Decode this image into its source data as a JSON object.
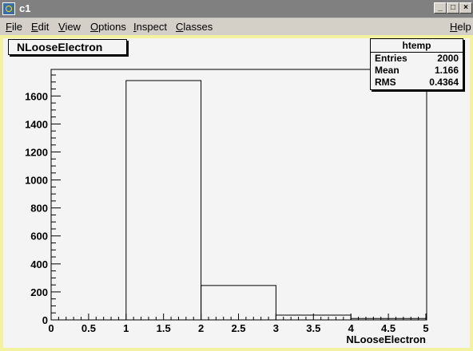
{
  "window": {
    "title": "c1",
    "minimize": "_",
    "maximize": "□",
    "close": "×"
  },
  "menu": {
    "file": {
      "accel": "F",
      "rest": "ile"
    },
    "edit": {
      "accel": "E",
      "rest": "dit"
    },
    "view": {
      "accel": "V",
      "rest": "iew"
    },
    "options": {
      "accel": "O",
      "rest": "ptions"
    },
    "inspect": {
      "accel": "I",
      "rest": "nspect"
    },
    "classes": {
      "accel": "C",
      "rest": "lasses"
    },
    "help": {
      "accel": "H",
      "rest": "elp"
    }
  },
  "pad": {
    "title": "NLooseElectron"
  },
  "stats": {
    "title": "htemp",
    "rows": [
      {
        "key": "Entries",
        "value": "2000"
      },
      {
        "key": "Mean",
        "value": "1.166"
      },
      {
        "key": "RMS",
        "value": "0.4364"
      }
    ]
  },
  "chart_data": {
    "type": "bar",
    "title": "NLooseElectron",
    "xlabel": "NLooseElectron",
    "ylabel": "",
    "bins": [
      {
        "low": 0,
        "high": 1,
        "value": 0
      },
      {
        "low": 1,
        "high": 2,
        "value": 1710
      },
      {
        "low": 2,
        "high": 3,
        "value": 246
      },
      {
        "low": 3,
        "high": 4,
        "value": 34
      },
      {
        "low": 4,
        "high": 5,
        "value": 10
      }
    ],
    "xlim": [
      0,
      5
    ],
    "ylim": [
      0,
      1790
    ],
    "xticks": [
      "0",
      "0.5",
      "1",
      "1.5",
      "2",
      "2.5",
      "3",
      "3.5",
      "4",
      "4.5",
      "5"
    ],
    "yticks": [
      "0",
      "200",
      "400",
      "600",
      "800",
      "1000",
      "1200",
      "1400",
      "1600"
    ],
    "grid": false,
    "legend": "top-right"
  },
  "colors": {
    "frame": "#f2f2a0",
    "canvas": "#f4f4f4",
    "titlebar": "#808080",
    "line": "#000000"
  }
}
